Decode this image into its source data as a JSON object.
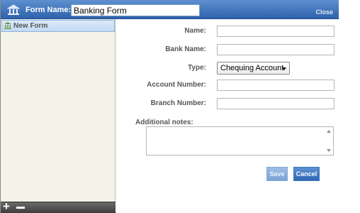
{
  "titlebar": {
    "form_name_label": "Form Name:",
    "form_name_value": "Banking Form",
    "close_label": "Close",
    "icon": "bank-icon"
  },
  "sidebar": {
    "items": [
      {
        "label": "New Form",
        "icon": "bank-icon"
      }
    ],
    "footer": {
      "add_icon": "plus-icon",
      "remove_icon": "minus-icon"
    }
  },
  "form": {
    "fields": {
      "name": {
        "label": "Name:",
        "value": ""
      },
      "bank_name": {
        "label": "Bank Name:",
        "value": ""
      },
      "type": {
        "label": "Type:",
        "selected": "Chequing Account"
      },
      "account_number": {
        "label": "Account Number:",
        "value": ""
      },
      "branch_number": {
        "label": "Branch Number:",
        "value": ""
      }
    },
    "notes": {
      "label": "Additional notes:",
      "value": ""
    },
    "buttons": {
      "save": "Save",
      "cancel": "Cancel"
    }
  },
  "colors": {
    "titlebar": "#2f62aa",
    "accent": "#3c75bd",
    "sidebar_bg": "#f3f3e9",
    "selected_item": "#c2daf3"
  }
}
